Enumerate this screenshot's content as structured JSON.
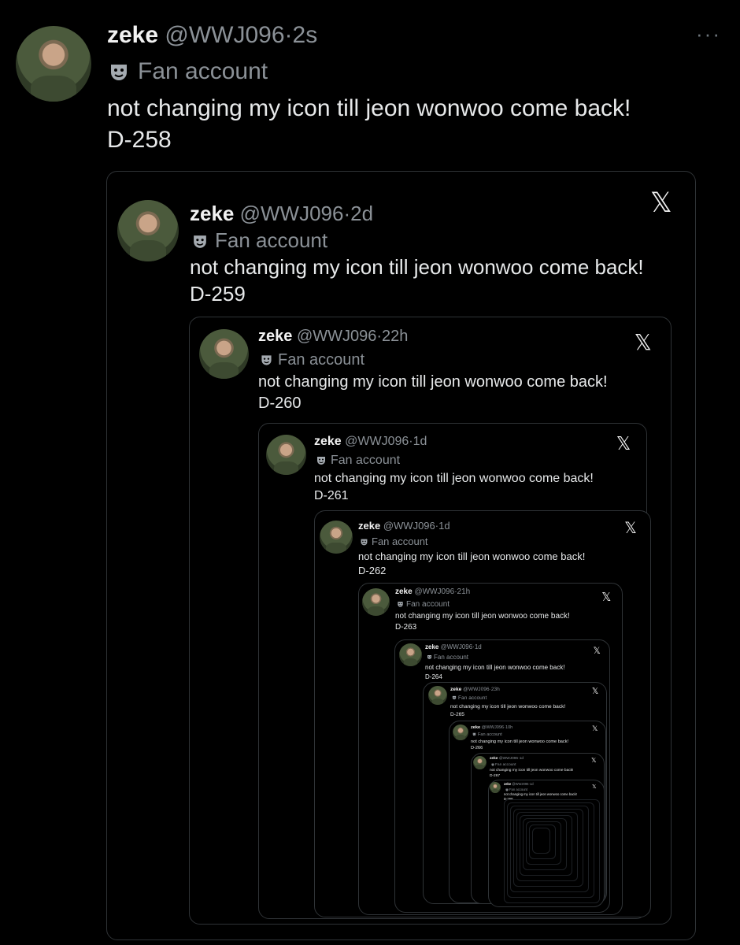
{
  "tweet": {
    "name": "zeke",
    "handle": "@WWJ096",
    "sep": "·",
    "time": "2s",
    "label": "Fan account",
    "text": "not changing my icon till jeon wonwoo come back!",
    "countdown": "D-258",
    "more_icon": "more-options-icon"
  },
  "quotes": [
    {
      "name": "zeke",
      "handle": "@WWJ096",
      "sep": "·",
      "time": "2d",
      "label": "Fan account",
      "text": "not changing my icon till jeon wonwoo come back!",
      "countdown": "D-259"
    },
    {
      "name": "zeke",
      "handle": "@WWJ096",
      "sep": "·",
      "time": "22h",
      "label": "Fan account",
      "text": "not changing my icon till jeon wonwoo come back!",
      "countdown": "D-260"
    },
    {
      "name": "zeke",
      "handle": "@WWJ096",
      "sep": "·",
      "time": "1d",
      "label": "Fan account",
      "text": "not changing my icon till jeon wonwoo come back!",
      "countdown": "D-261"
    },
    {
      "name": "zeke",
      "handle": "@WWJ096",
      "sep": "·",
      "time": "1d",
      "label": "Fan account",
      "text": "not changing my icon till jeon wonwoo come back!",
      "countdown": "D-262"
    },
    {
      "name": "zeke",
      "handle": "@WWJ096",
      "sep": "·",
      "time": "21h",
      "label": "Fan account",
      "text": "not changing my icon till jeon wonwoo come back!",
      "countdown": "D-263"
    },
    {
      "name": "zeke",
      "handle": "@WWJ096",
      "sep": "·",
      "time": "1d",
      "label": "Fan account",
      "text": "not changing my icon till jeon wonwoo come back!",
      "countdown": "D-264"
    },
    {
      "name": "zeke",
      "handle": "@WWJ096",
      "sep": "·",
      "time": "23h",
      "label": "Fan account",
      "text": "not changing my icon till jeon wonwoo come back!",
      "countdown": "D-265"
    },
    {
      "name": "zeke",
      "handle": "@WWJ096",
      "sep": "·",
      "time": "10h",
      "label": "Fan account",
      "text": "not changing my icon till jeon wonwoo come back!",
      "countdown": "D-266"
    },
    {
      "name": "zeke",
      "handle": "@WWJ096",
      "sep": "·",
      "time": "1d",
      "label": "Fan account",
      "text": "not changing my icon till jeon wonwoo come back!",
      "countdown": "D-267"
    },
    {
      "name": "zeke",
      "handle": "@WWJ096",
      "sep": "·",
      "time": "1d",
      "label": "Fan account",
      "text": "not changing my icon till jeon wonwoo come back!",
      "countdown": "D-268"
    }
  ],
  "icons": {
    "close": "x-logo-icon",
    "label": "mask-icon"
  },
  "colors": {
    "background": "#000000",
    "text": "#e7e9ea",
    "muted": "#8b9197",
    "border": "#2f3336"
  }
}
